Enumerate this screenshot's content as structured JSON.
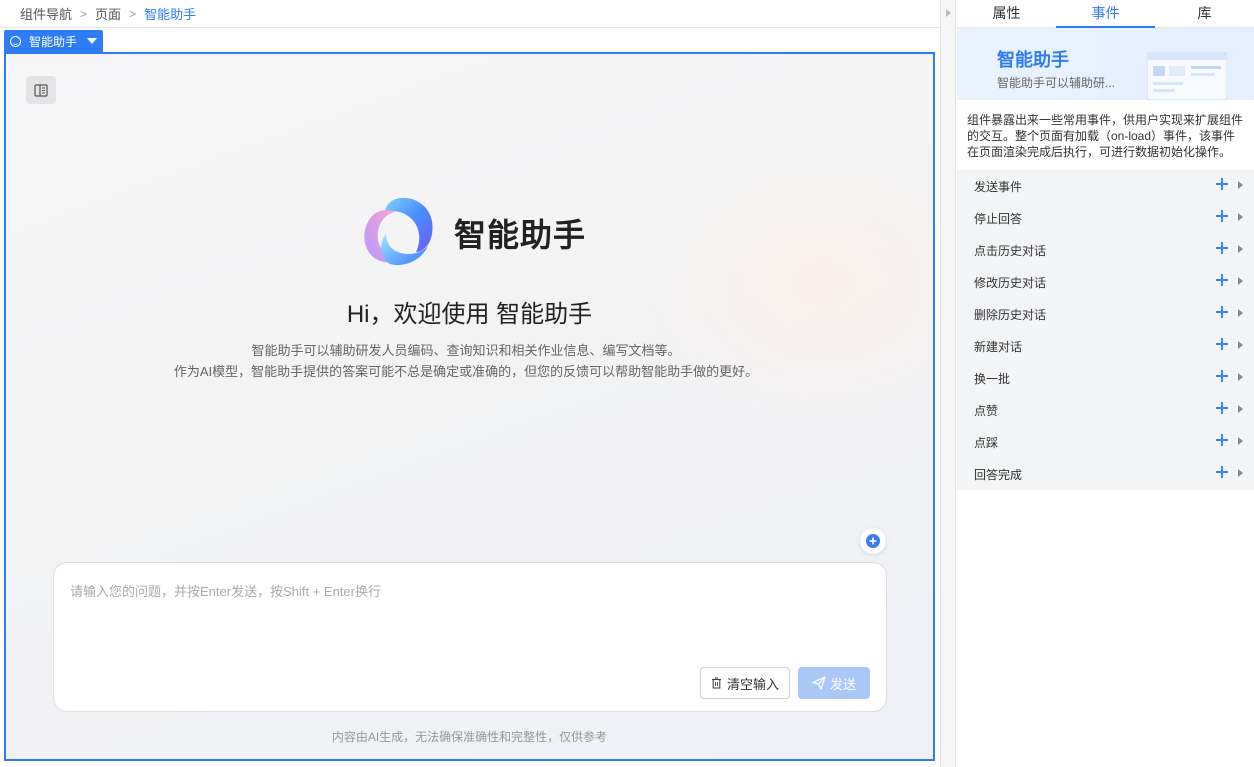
{
  "breadcrumb": [
    "组件导航",
    "页面",
    "智能助手"
  ],
  "component_tag": "智能助手",
  "assistant": {
    "name": "智能助手",
    "welcome": "Hi，欢迎使用 智能助手",
    "desc_line1": "智能助手可以辅助研发人员编码、查询知识和相关作业信息、编写文档等。",
    "desc_line2": "作为AI模型，智能助手提供的答案可能不总是确定或准确的，但您的反馈可以帮助智能助手做的更好。",
    "input_placeholder": "请输入您的问题，并按Enter发送，按Shift + Enter换行",
    "clear_label": "清空输入",
    "send_label": "发送",
    "disclaimer": "内容由AI生成，无法确保准确性和完整性，仅供参考"
  },
  "panel": {
    "tabs": [
      "属性",
      "事件",
      "库"
    ],
    "active_tab": 1,
    "hero_title": "智能助手",
    "hero_sub": "智能助手可以辅助研...",
    "intro": "组件暴露出来一些常用事件，供用户实现来扩展组件的交互。整个页面有加载（on-load）事件，该事件在页面渲染完成后执行，可进行数据初始化操作。",
    "events": [
      "发送事件",
      "停止回答",
      "点击历史对话",
      "修改历史对话",
      "删除历史对话",
      "新建对话",
      "换一批",
      "点赞",
      "点踩",
      "回答完成"
    ]
  },
  "colors": {
    "accent": "#2e7df6",
    "send_disabled": "#a9c8f8"
  }
}
